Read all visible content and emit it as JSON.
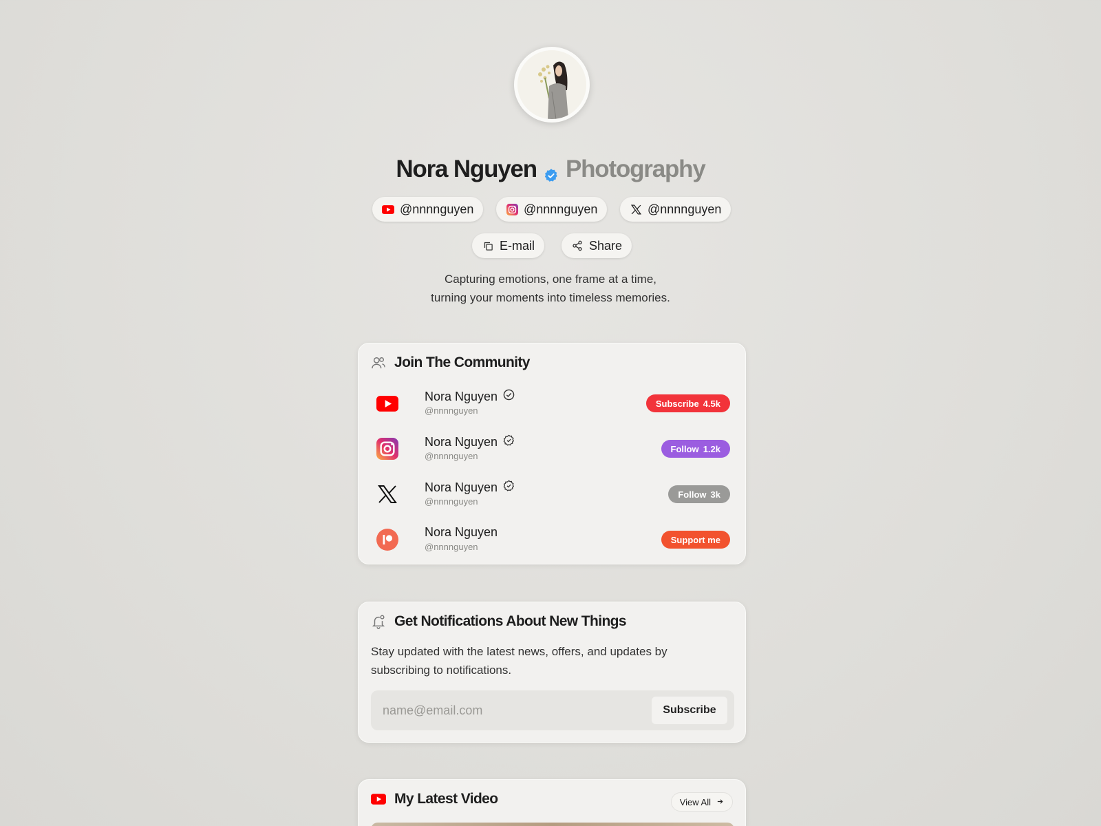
{
  "profile": {
    "name": "Nora Nguyen",
    "category": "Photography",
    "bio_line1": "Capturing emotions, one frame at a time,",
    "bio_line2": "turning your moments into timeless memories."
  },
  "social_pills": [
    {
      "icon": "youtube-icon",
      "label": "@nnnnguyen"
    },
    {
      "icon": "instagram-icon",
      "label": "@nnnnguyen"
    },
    {
      "icon": "x-icon",
      "label": "@nnnnguyen"
    }
  ],
  "actions": {
    "email_label": "E-mail",
    "share_label": "Share"
  },
  "community": {
    "title": "Join The Community",
    "rows": [
      {
        "icon": "youtube-icon",
        "name": "Nora Nguyen",
        "handle": "@nnnnguyen",
        "button": "Subscribe",
        "count": "4.5k",
        "color": "#f2333a"
      },
      {
        "icon": "instagram-icon",
        "name": "Nora Nguyen",
        "handle": "@nnnnguyen",
        "button": "Follow",
        "count": "1.2k",
        "color": "#9b5de0"
      },
      {
        "icon": "x-icon",
        "name": "Nora Nguyen",
        "handle": "@nnnnguyen",
        "button": "Follow",
        "count": "3k",
        "color": "#9a9a98"
      },
      {
        "icon": "patreon-icon",
        "name": "Nora Nguyen",
        "handle": "@nnnnguyen",
        "button": "Support me",
        "count": "",
        "color": "#f2522e"
      }
    ]
  },
  "notifications": {
    "title": "Get Notifications About New Things",
    "text_line1": "Stay updated with the latest news, offers, and updates by",
    "text_line2": "subscribing to notifications.",
    "placeholder": "name@email.com",
    "button": "Subscribe"
  },
  "latest_video": {
    "title": "My Latest Video",
    "view_all": "View All"
  },
  "colors": {
    "accent_blue": "#3c9cf0",
    "youtube_red": "#f00"
  }
}
